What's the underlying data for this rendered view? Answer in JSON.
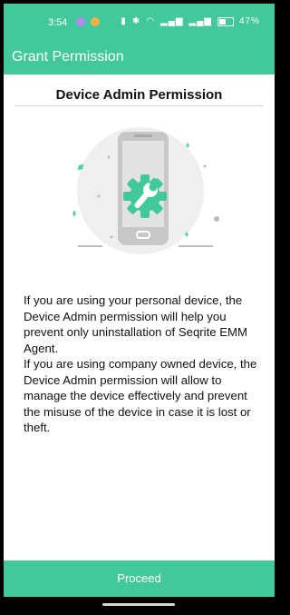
{
  "status_bar": {
    "time": "3:54",
    "battery": "47%",
    "indicators": [
      "vibrate-icon",
      "bluetooth-icon",
      "wifi-icon",
      "signal-icon",
      "battery-icon"
    ]
  },
  "app_bar": {
    "title": "Grant Permission"
  },
  "content": {
    "heading": "Device Admin Permission",
    "illustration": "phone-with-wrench-gear-icon",
    "paragraph1": "If you are using your personal device, the Device Admin permission will help you prevent only uninstallation of Seqrite EMM Agent.",
    "paragraph2": "If you are using company owned device, the Device Admin permission will allow to manage the device effectively and prevent the misuse of the device in case it is lost or theft."
  },
  "footer": {
    "proceed_label": "Proceed"
  },
  "colors": {
    "accent": "#43c79d",
    "illustration_circle": "#efefef",
    "phone": "#c7c7c7",
    "gear": "#41c99a"
  }
}
